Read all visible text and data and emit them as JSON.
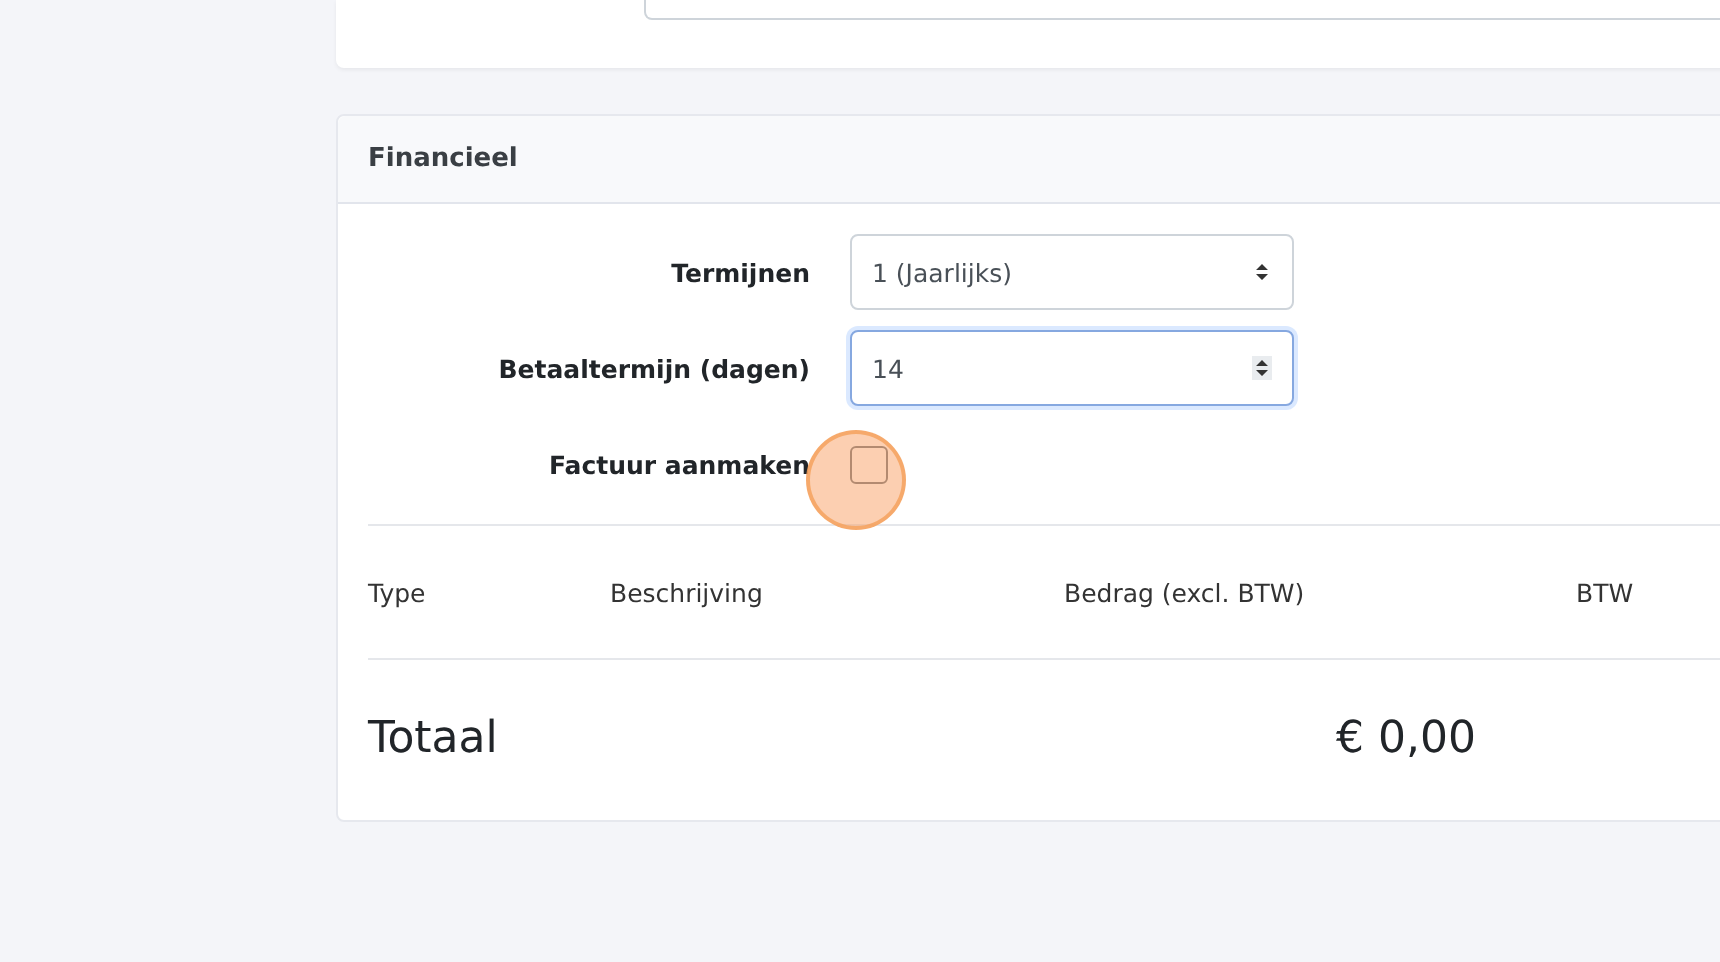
{
  "financial_card": {
    "title": "Financieel",
    "fields": [
      {
        "kind": "select",
        "label": "Termijnen",
        "value": "1 (Jaarlijks)",
        "focused": false
      },
      {
        "kind": "number",
        "label": "Betaaltermijn (dagen)",
        "value": "14",
        "focused": true
      },
      {
        "kind": "checkbox",
        "label": "Factuur aanmaken",
        "checked": false
      }
    ],
    "table": {
      "columns": [
        "Type",
        "Beschrijving",
        "Bedrag (excl. BTW)",
        "BTW"
      ]
    },
    "total": {
      "label": "Totaal",
      "amount": "€ 0,00"
    }
  }
}
